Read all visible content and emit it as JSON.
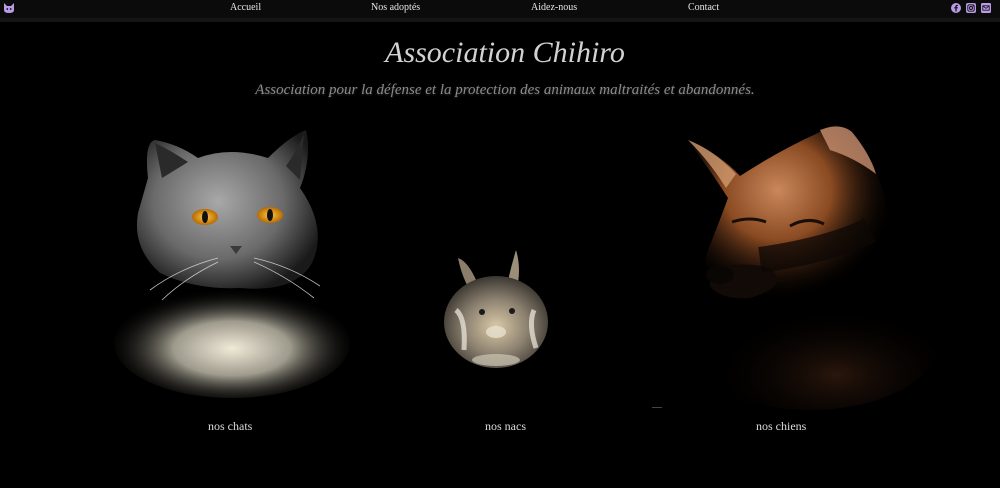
{
  "nav": {
    "links": [
      {
        "label": "Accueil"
      },
      {
        "label": "Nos adoptés"
      },
      {
        "label": "Aidez-nous"
      },
      {
        "label": "Contact"
      }
    ],
    "social": [
      "facebook-icon",
      "instagram-icon",
      "mail-icon"
    ],
    "accent": "#b99be6"
  },
  "header": {
    "title": "Association Chihiro",
    "subtitle": "Association pour la défense et la protection des animaux maltraités et abandonnés."
  },
  "animals": [
    {
      "label": "nos chats"
    },
    {
      "label": "nos nacs"
    },
    {
      "label": "nos chiens"
    }
  ]
}
